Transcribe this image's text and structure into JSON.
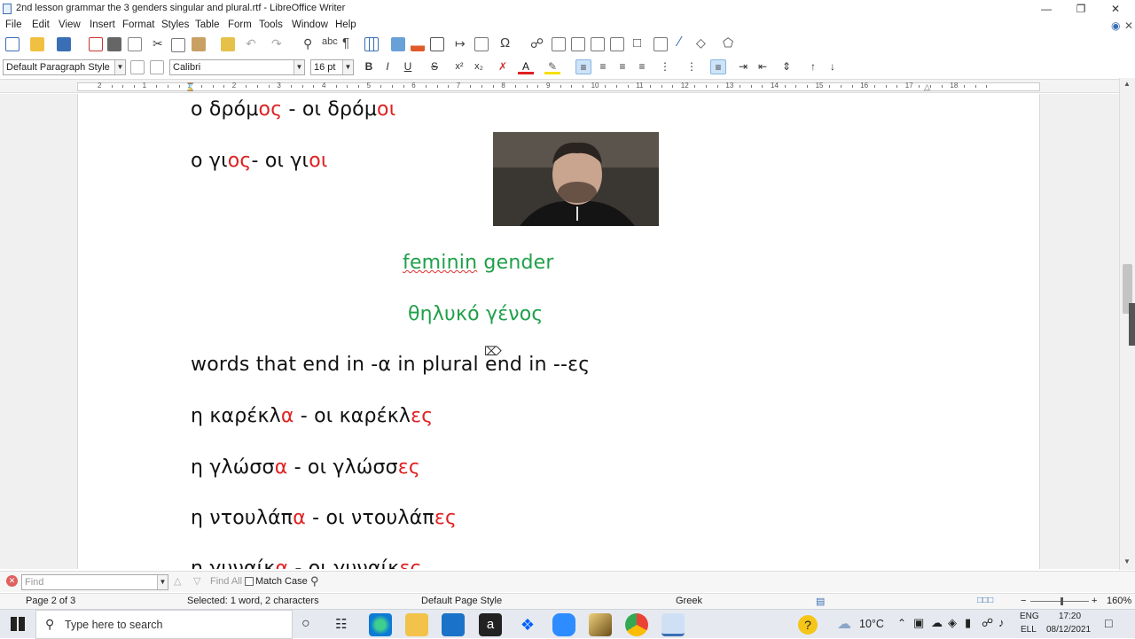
{
  "window": {
    "title": "2nd lesson grammar the 3 genders singular and plural.rtf - LibreOffice Writer"
  },
  "menu": [
    "File",
    "Edit",
    "View",
    "Insert",
    "Format",
    "Styles",
    "Table",
    "Form",
    "Tools",
    "Window",
    "Help"
  ],
  "toolbar": {
    "paragraph_style": "Default Paragraph Style",
    "font_name": "Calibri",
    "font_size": "16 pt",
    "bold": "B",
    "italic": "I",
    "underline": "U",
    "strikethrough": "S"
  },
  "ruler": {
    "numbers": [
      "2",
      "1",
      "1",
      "2",
      "3",
      "4",
      "5",
      "6",
      "7",
      "8",
      "9",
      "10",
      "11",
      "12",
      "13",
      "14",
      "15",
      "16",
      "17",
      "18"
    ]
  },
  "document": {
    "line1": {
      "a": "ο δρόμ",
      "b": "ος",
      "c": " - οι δρόμ",
      "d": "οι"
    },
    "line2": {
      "a": "ο γι",
      "b": "ος",
      "c": "- οι γι",
      "d": "οι"
    },
    "heading1": "feminin gender",
    "heading2": "θηλυκό γένος",
    "rule": "words that end in -α in plural end in --ες",
    "ex1": {
      "a": "η καρέκλ",
      "b": "α",
      "c": " - οι καρέκλ",
      "d": "ες"
    },
    "ex2": {
      "a": "η γλώσσ",
      "b": "α",
      "c": " - οι γλώσσ",
      "d": "ες"
    },
    "ex3": {
      "a": "η ντουλάπ",
      "b": "α",
      "c": " - οι ντουλάπ",
      "d": "ες"
    },
    "ex4": {
      "a": "η γυναίκ",
      "b": "α",
      "c": " - οι γυναίκ",
      "d": "ες"
    }
  },
  "findbar": {
    "placeholder": "Find",
    "find_all": "Find All",
    "match_case": "Match Case"
  },
  "status": {
    "page": "Page 2 of 3",
    "selection": "Selected: 1 word, 2 characters",
    "page_style": "Default Page Style",
    "language": "Greek",
    "zoom": "160%"
  },
  "taskbar": {
    "search_placeholder": "Type here to search",
    "weather": "10°C",
    "lang_line1": "ENG",
    "lang_line2": "ELL",
    "time": "17:20",
    "date": "08/12/2021"
  },
  "colors": {
    "ending_red": "#e02020",
    "heading_green": "#1fa04a",
    "accent_blue": "#cde3f8"
  }
}
